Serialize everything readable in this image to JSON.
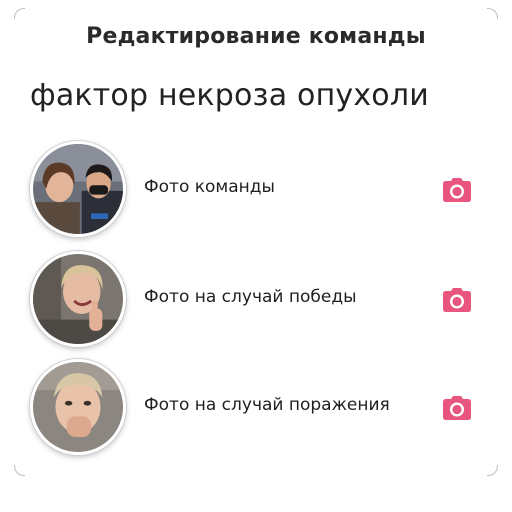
{
  "header": {
    "title": "Редактирование команды"
  },
  "team": {
    "name": "фактор некроза опухоли"
  },
  "photo_slots": [
    {
      "label": "Фото команды",
      "icon": "camera-icon"
    },
    {
      "label": "Фото на случай победы",
      "icon": "camera-icon"
    },
    {
      "label": "Фото на случай поражения",
      "icon": "camera-icon"
    }
  ],
  "colors": {
    "accent": "#e8557f",
    "text": "#1f1f1f",
    "background": "#ffffff"
  }
}
